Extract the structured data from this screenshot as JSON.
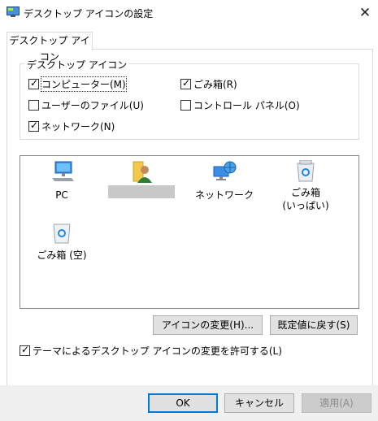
{
  "window": {
    "title": "デスクトップ アイコンの設定",
    "close_glyph": "✕"
  },
  "tab": {
    "label": "デスクトップ アイコン"
  },
  "group": {
    "legend": "デスクトップ アイコン",
    "checkboxes": [
      {
        "label": "コンピューター(M)",
        "checked": true
      },
      {
        "label": "ごみ箱(R)",
        "checked": true
      },
      {
        "label": "ユーザーのファイル(U)",
        "checked": false
      },
      {
        "label": "コントロール パネル(O)",
        "checked": false
      },
      {
        "label": "ネットワーク(N)",
        "checked": true
      }
    ]
  },
  "icons": [
    {
      "label": "PC",
      "icon": "computer-icon"
    },
    {
      "label": "",
      "icon": "user-folder-icon"
    },
    {
      "label": "ネットワーク",
      "icon": "network-icon"
    },
    {
      "label": "ごみ箱\n(いっぱい)",
      "icon": "recycle-bin-full-icon"
    },
    {
      "label": "ごみ箱 (空)",
      "icon": "recycle-bin-empty-icon"
    }
  ],
  "buttons": {
    "change_icon": "アイコンの変更(H)...",
    "restore_default": "既定値に戻す(S)",
    "ok": "OK",
    "cancel": "キャンセル",
    "apply": "適用(A)"
  },
  "theme_checkbox": {
    "label": "テーマによるデスクトップ アイコンの変更を許可する(L)",
    "checked": true
  },
  "colors": {
    "accent": "#0078d7",
    "dialog_bg": "#f0f0f0",
    "button_bg": "#e1e1e1"
  }
}
